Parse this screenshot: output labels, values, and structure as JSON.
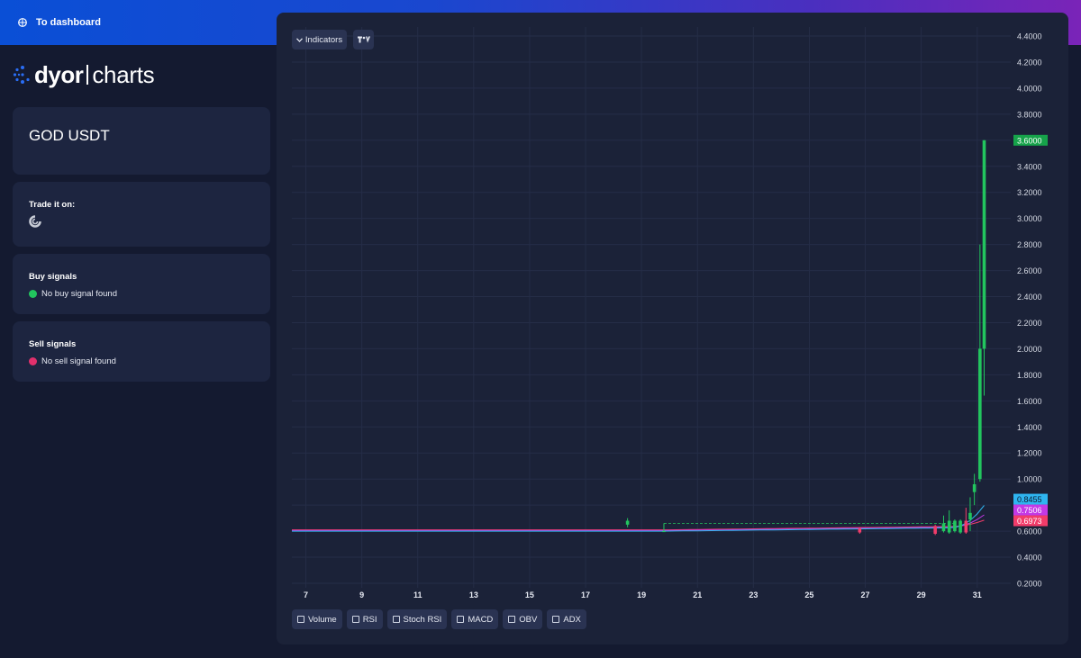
{
  "header": {
    "dashboard_link": "To dashboard"
  },
  "logo": {
    "part1": "dyor",
    "part2": "charts"
  },
  "pair": {
    "title": "GOD USDT"
  },
  "trade": {
    "label": "Trade it on:"
  },
  "buy": {
    "label": "Buy signals",
    "status": "No buy signal found"
  },
  "sell": {
    "label": "Sell signals",
    "status": "No sell signal found"
  },
  "chart_toolbar": {
    "indicators_label": "Indicators",
    "tv_logo": "TV"
  },
  "indicator_toggles": [
    "Volume",
    "RSI",
    "Stoch RSI",
    "MACD",
    "OBV",
    "ADX"
  ],
  "colors": {
    "up": "#22c55e",
    "down": "#f23c6a",
    "price_badge": "#16a34a",
    "ma1": "#2fb5f0",
    "ma2": "#c339e6",
    "ma3": "#f23c6a"
  },
  "chart_data": {
    "type": "candlestick",
    "y_ticks": [
      "4.4000",
      "4.2000",
      "4.0000",
      "3.8000",
      "3.6000",
      "3.4000",
      "3.2000",
      "3.0000",
      "2.8000",
      "2.6000",
      "2.4000",
      "2.2000",
      "2.0000",
      "1.8000",
      "1.6000",
      "1.4000",
      "1.2000",
      "1.0000",
      "0.8000",
      "0.6000",
      "0.4000",
      "0.2000"
    ],
    "y_range": [
      0.2,
      4.4
    ],
    "x_ticks": [
      "7",
      "9",
      "11",
      "13",
      "15",
      "17",
      "19",
      "21",
      "23",
      "25",
      "27",
      "29",
      "31"
    ],
    "x_range": [
      6.5,
      32.2
    ],
    "grid": true,
    "last_price_label": "3.6000",
    "ma_labels": [
      {
        "value": "0.8455",
        "name": "ma1"
      },
      {
        "value": "0.7506",
        "name": "ma2"
      },
      {
        "value": "0.6973",
        "name": "ma3"
      }
    ],
    "candles": [
      {
        "day": 18.5,
        "open": 0.65,
        "high": 0.7,
        "low": 0.63,
        "close": 0.68
      },
      {
        "day": 19.8,
        "open": 0.6,
        "high": 0.66,
        "low": 0.6,
        "close": 0.6
      },
      {
        "day": 26.8,
        "open": 0.62,
        "high": 0.63,
        "low": 0.58,
        "close": 0.59
      },
      {
        "day": 29.5,
        "open": 0.64,
        "high": 0.65,
        "low": 0.57,
        "close": 0.58
      },
      {
        "day": 29.8,
        "open": 0.6,
        "high": 0.72,
        "low": 0.59,
        "close": 0.66
      },
      {
        "day": 30.0,
        "open": 0.59,
        "high": 0.76,
        "low": 0.58,
        "close": 0.68
      },
      {
        "day": 30.2,
        "open": 0.6,
        "high": 0.69,
        "low": 0.59,
        "close": 0.68
      },
      {
        "day": 30.4,
        "open": 0.59,
        "high": 0.69,
        "low": 0.58,
        "close": 0.68
      },
      {
        "day": 30.6,
        "open": 0.68,
        "high": 0.78,
        "low": 0.58,
        "close": 0.59
      },
      {
        "day": 30.75,
        "open": 0.69,
        "high": 0.86,
        "low": 0.6,
        "close": 0.74
      },
      {
        "day": 30.9,
        "open": 0.9,
        "high": 1.04,
        "low": 0.8,
        "close": 0.96
      },
      {
        "day": 31.1,
        "open": 1.0,
        "high": 2.8,
        "low": 0.98,
        "close": 2.0
      },
      {
        "day": 31.25,
        "open": 2.0,
        "high": 3.6,
        "low": 1.64,
        "close": 3.6
      }
    ]
  }
}
